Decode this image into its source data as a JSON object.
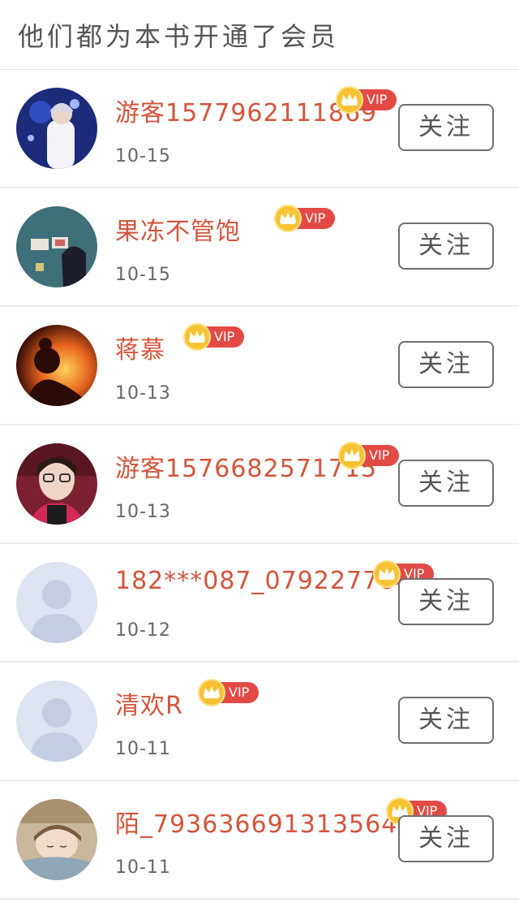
{
  "header": {
    "title": "他们都为本书开通了会员"
  },
  "members": [
    {
      "name": "游客1577962111869",
      "date": "10-15",
      "badge": "VIP",
      "follow_label": "关注",
      "avatar": "avatar-stage-photo"
    },
    {
      "name": "果冻不管饱",
      "date": "10-15",
      "badge": "VIP",
      "follow_label": "关注",
      "avatar": "avatar-illustration"
    },
    {
      "name": "蒋慕",
      "date": "10-13",
      "badge": "VIP",
      "follow_label": "关注",
      "avatar": "avatar-sunset-silhouette"
    },
    {
      "name": "游客1576682571715",
      "date": "10-13",
      "badge": "VIP",
      "follow_label": "关注",
      "avatar": "avatar-selfie"
    },
    {
      "name": "182***087_0792277612",
      "date": "10-12",
      "badge": "VIP",
      "follow_label": "关注",
      "avatar": "avatar-default-person"
    },
    {
      "name": "清欢R",
      "date": "10-11",
      "badge": "VIP",
      "follow_label": "关注",
      "avatar": "avatar-default-person"
    },
    {
      "name": "陌_7936366913135647​06",
      "date": "10-11",
      "badge": "VIP",
      "follow_label": "关注",
      "avatar": "avatar-sleeping-girl"
    }
  ],
  "colors": {
    "name": "#d4543c",
    "vip_badge": "#e34a45",
    "crown": "#f7c233"
  }
}
